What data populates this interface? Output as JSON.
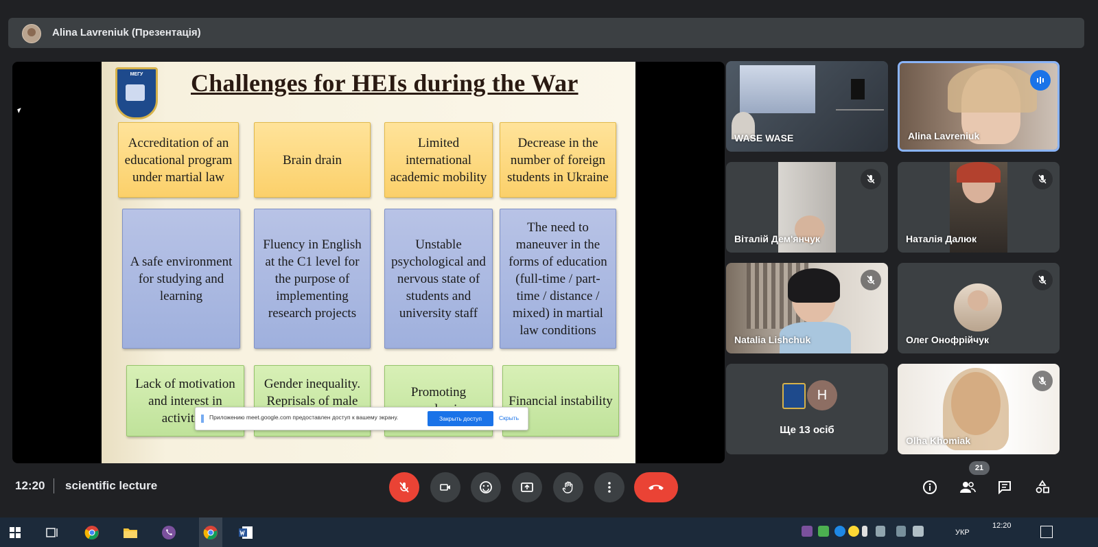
{
  "header": {
    "presenter_label": "Alina Lavreniuk (Презентація)"
  },
  "slide": {
    "title": "Challenges for HEIs during the War",
    "logo_text": "МЕГУ",
    "boxes": [
      "Accreditation of an educational program under martial law",
      "Brain drain",
      "Limited international academic mobility",
      "Decrease in the number of foreign students in Ukraine",
      "A safe environment for studying and learning",
      "Fluency in English at the C1 level for the purpose of implementing research projects",
      "Unstable psychological and nervous state of students and university staff",
      "The need to maneuver in the forms of education (full-time / part-time / distance / mixed) in martial law conditions",
      "Lack of motivation and interest in activities",
      "Gender inequality. Reprisals of male scientists",
      "Promoting academic",
      "Financial instability"
    ]
  },
  "share_banner": {
    "text": "Приложению meet.google.com предоставлен доступ к вашему экрану.",
    "stop_label": "Закрыть доступ",
    "hide_label": "Скрыть"
  },
  "participants": [
    {
      "name": "WASE WASE",
      "muted": false
    },
    {
      "name": "Alina Lavreniuk",
      "muted": false,
      "speaking": true
    },
    {
      "name": "Віталій Дем'янчук",
      "muted": true
    },
    {
      "name": "Наталія Далюк",
      "muted": true
    },
    {
      "name": "Natalia Lishchuk",
      "muted": true
    },
    {
      "name": "Олег Онофрійчук",
      "muted": true
    },
    {
      "name": "Ще 13 осіб",
      "avatar_letter": "H"
    },
    {
      "name": "Olha Khomiak",
      "muted": true
    }
  ],
  "footer": {
    "time": "12:20",
    "meeting_title": "scientific lecture",
    "participant_count": "21"
  },
  "taskbar": {
    "lang": "УКР",
    "clock": "12:20"
  },
  "colors": {
    "background": "#202124",
    "tile": "#3c4043",
    "red": "#ea4335",
    "accent": "#1a73e8"
  }
}
